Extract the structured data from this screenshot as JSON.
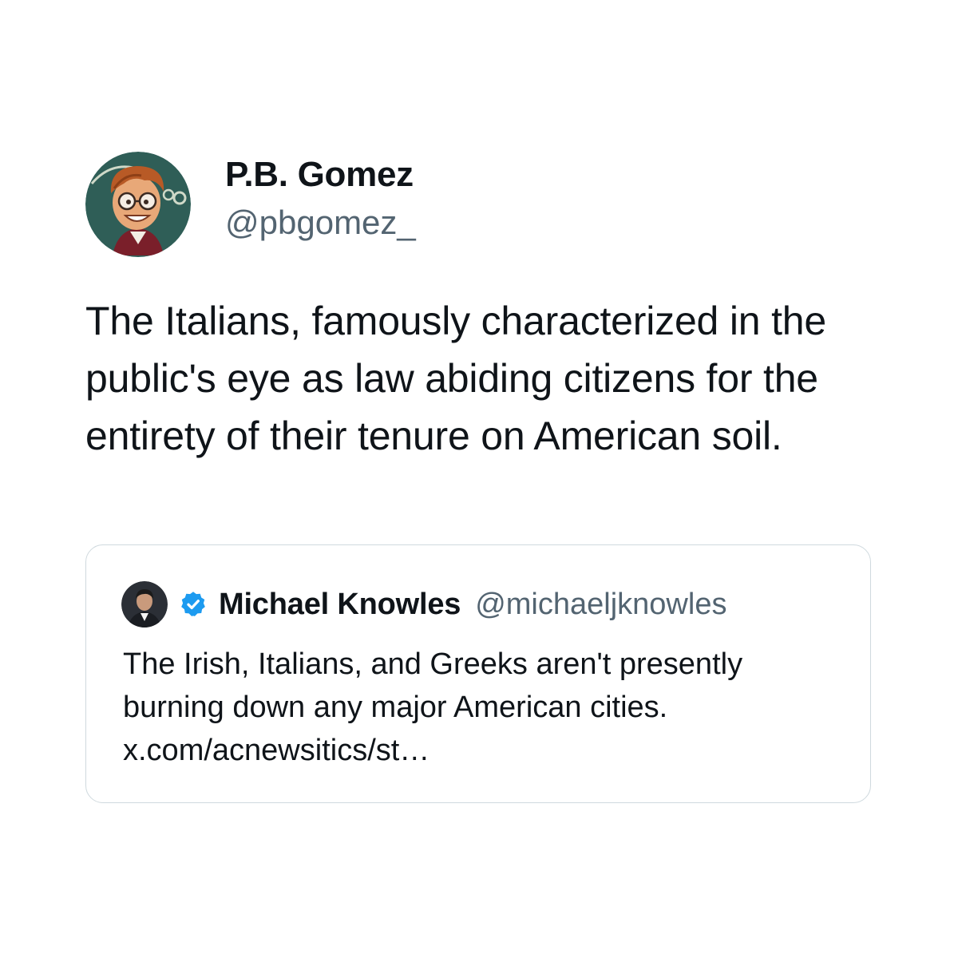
{
  "tweet": {
    "display_name": "P.B. Gomez",
    "handle": "@pbgomez_",
    "avatar_icon": "cartoon-avatar-icon",
    "text": "The Italians, famously characterized in the public's eye as law abiding citizens for the entirety of their tenure on American soil."
  },
  "quoted_tweet": {
    "display_name": "Michael Knowles",
    "handle": "@michaeljknowles",
    "avatar_icon": "profile-photo-icon",
    "verified_icon": "verified-badge-icon",
    "text": "The Irish, Italians, and Greeks aren't presently burning down any major American cities. x.com/acnewsitics/st…"
  },
  "colors": {
    "text": "#0f1419",
    "secondary_text": "#536471",
    "border": "#cfd9de",
    "verified": "#1d9bf0",
    "background": "#ffffff"
  }
}
